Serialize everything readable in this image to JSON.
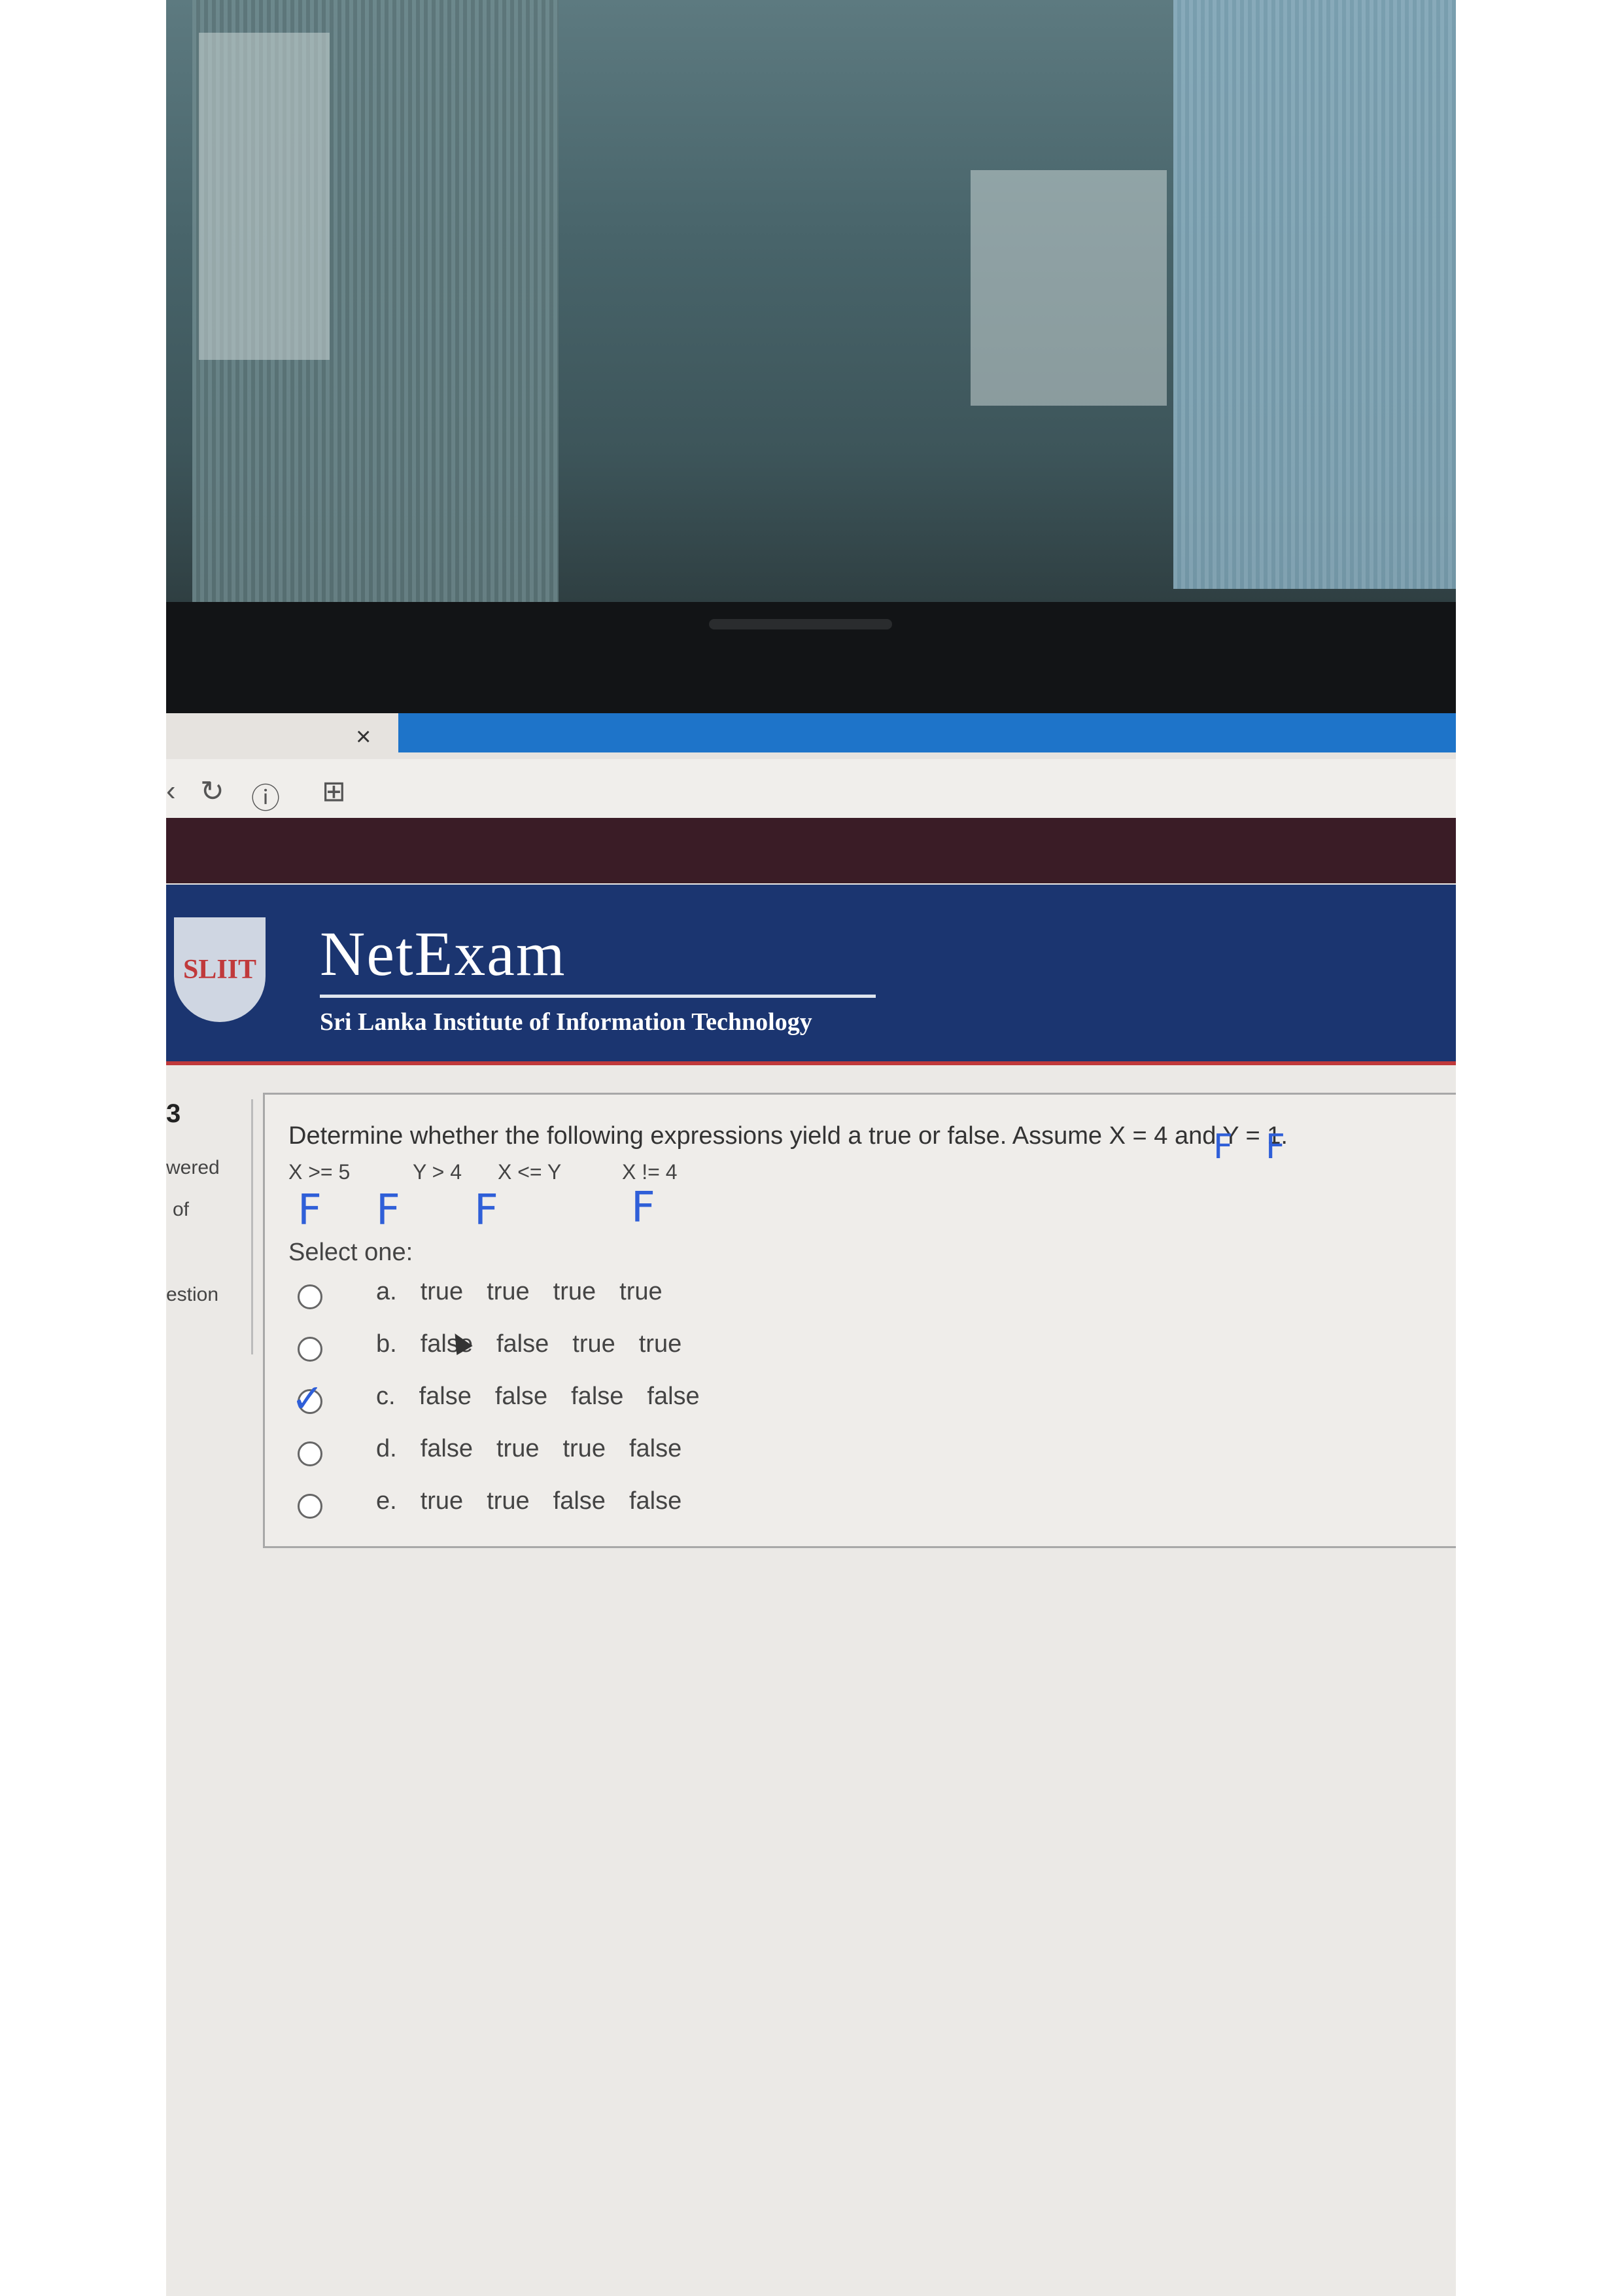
{
  "browser": {
    "tab_close": "×",
    "icons": [
      "back-icon",
      "reload-icon",
      "info-icon",
      "bookmark-icon"
    ],
    "back": "‹",
    "reload": "↻",
    "info": "ⓘ",
    "bookmark": "⊞"
  },
  "header": {
    "logo_text": "SLIIT",
    "app_name": "NetExam",
    "institute": "Sri Lanka Institute of Information Technology"
  },
  "left_nav": {
    "number": "3",
    "line1": "wered",
    "line2": "of",
    "line3": "estion"
  },
  "question": {
    "text": "Determine whether the following expressions yield a true or false. Assume X = 4 and Y = 1.",
    "expressions": [
      "X >= 5",
      "Y > 4",
      "X <= Y",
      "X != 4"
    ],
    "select_label": "Select one:",
    "options": [
      {
        "letter": "a.",
        "values": [
          "true",
          "true",
          "true",
          "true"
        ]
      },
      {
        "letter": "b.",
        "values": [
          "false",
          "false",
          "true",
          "true"
        ]
      },
      {
        "letter": "c.",
        "values": [
          "false",
          "false",
          "false",
          "false"
        ]
      },
      {
        "letter": "d.",
        "values": [
          "false",
          "true",
          "true",
          "false"
        ]
      },
      {
        "letter": "e.",
        "values": [
          "true",
          "true",
          "false",
          "false"
        ]
      }
    ]
  },
  "handwriting": {
    "marks": [
      "F",
      "F",
      "F",
      "F",
      "F",
      "F"
    ],
    "check": "✓"
  },
  "colors": {
    "header_bg": "#1b3570",
    "accent_red": "#c0393b",
    "tab_blue": "#1e74c9",
    "ink_blue": "#2f5fd8"
  }
}
